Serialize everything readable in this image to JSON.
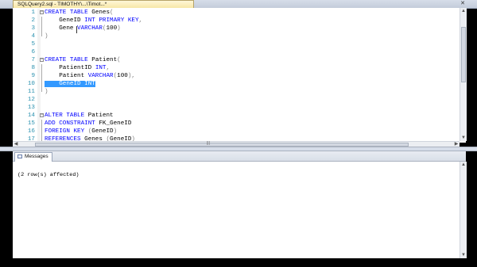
{
  "tab": {
    "title": "SQLQuery2.sql - TIMOTHY\\...\\Timot...*"
  },
  "editor": {
    "lines": [
      {
        "num": "1",
        "tokens": [
          {
            "t": "CREATE",
            "c": "kw"
          },
          {
            "t": " "
          },
          {
            "t": "TABLE",
            "c": "kw"
          },
          {
            "t": " Genes"
          },
          {
            "t": "(",
            "c": "gy"
          }
        ]
      },
      {
        "num": "2",
        "tokens": [
          {
            "t": "    GeneID "
          },
          {
            "t": "INT",
            "c": "ty"
          },
          {
            "t": " "
          },
          {
            "t": "PRIMARY KEY",
            "c": "kw"
          },
          {
            "t": ",",
            "c": "gy"
          }
        ]
      },
      {
        "num": "3",
        "tokens": [
          {
            "t": "    Gene "
          },
          {
            "t": "VARCHAR",
            "c": "ty"
          },
          {
            "t": "(",
            "c": "gy"
          },
          {
            "t": "100"
          },
          {
            "t": ")",
            "c": "gy"
          }
        ]
      },
      {
        "num": "4",
        "tokens": [
          {
            "t": ")",
            "c": "gy"
          }
        ]
      },
      {
        "num": "5",
        "tokens": []
      },
      {
        "num": "6",
        "tokens": []
      },
      {
        "num": "7",
        "tokens": [
          {
            "t": "CREATE",
            "c": "kw"
          },
          {
            "t": " "
          },
          {
            "t": "TABLE",
            "c": "kw"
          },
          {
            "t": " Patient"
          },
          {
            "t": "(",
            "c": "gy"
          }
        ]
      },
      {
        "num": "8",
        "tokens": [
          {
            "t": "    PatientID "
          },
          {
            "t": "INT",
            "c": "ty"
          },
          {
            "t": ",",
            "c": "gy"
          }
        ]
      },
      {
        "num": "9",
        "tokens": [
          {
            "t": "    Patient "
          },
          {
            "t": "VARCHAR",
            "c": "ty"
          },
          {
            "t": "(",
            "c": "gy"
          },
          {
            "t": "100"
          },
          {
            "t": ")",
            "c": "gy"
          },
          {
            "t": ",",
            "c": "gy"
          }
        ]
      },
      {
        "num": "10",
        "tokens": [
          {
            "t": "    GeneID ",
            "c": "sel"
          },
          {
            "t": "INT",
            "c": "sel"
          }
        ]
      },
      {
        "num": "11",
        "tokens": [
          {
            "t": ")",
            "c": "gy"
          }
        ]
      },
      {
        "num": "12",
        "tokens": []
      },
      {
        "num": "13",
        "tokens": []
      },
      {
        "num": "14",
        "tokens": [
          {
            "t": "ALTER",
            "c": "kw"
          },
          {
            "t": " "
          },
          {
            "t": "TABLE",
            "c": "kw"
          },
          {
            "t": " Patient"
          }
        ]
      },
      {
        "num": "15",
        "tokens": [
          {
            "t": "ADD",
            "c": "kw"
          },
          {
            "t": " "
          },
          {
            "t": "CONSTRAINT",
            "c": "kw"
          },
          {
            "t": " FK_GeneID"
          }
        ]
      },
      {
        "num": "16",
        "tokens": [
          {
            "t": "FOREIGN KEY",
            "c": "kw"
          },
          {
            "t": " "
          },
          {
            "t": "(",
            "c": "gy"
          },
          {
            "t": "GeneID"
          },
          {
            "t": ")",
            "c": "gy"
          }
        ]
      },
      {
        "num": "17",
        "tokens": [
          {
            "t": "REFERENCES",
            "c": "kw"
          },
          {
            "t": " Genes "
          },
          {
            "t": "(",
            "c": "gy"
          },
          {
            "t": "GeneID"
          },
          {
            "t": ")",
            "c": "gy"
          }
        ]
      }
    ]
  },
  "results": {
    "tab_label": "Messages",
    "message": "(2 row(s) affected)"
  }
}
